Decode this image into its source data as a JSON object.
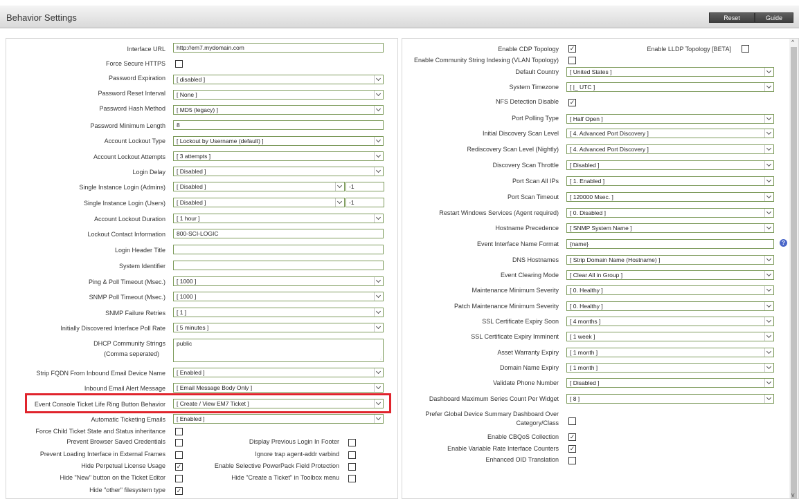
{
  "header": {
    "title": "Behavior Settings",
    "reset_label": "Reset",
    "guide_label": "Guide"
  },
  "left": {
    "url_label": "Interface URL",
    "url_value": "http://em7.mydomain.com",
    "https_label": "Force Secure HTTPS",
    "pw_exp_label": "Password Expiration",
    "pw_exp_value": "[ disabled ]",
    "pw_reset_label": "Password Reset Interval",
    "pw_reset_value": "[ None ]",
    "pw_hash_label": "Password Hash Method",
    "pw_hash_value": "[ MD5 (legacy) ]",
    "pw_min_label": "Password Minimum Length",
    "pw_min_value": "8",
    "lock_type_label": "Account Lockout Type",
    "lock_type_value": "[ Lockout by Username (default) ]",
    "lock_att_label": "Account Lockout Attempts",
    "lock_att_value": "[ 3 attempts ]",
    "login_delay_label": "Login Delay",
    "login_delay_value": "[ Disabled ]",
    "sil_admin_label": "Single Instance Login (Admins)",
    "sil_admin_value": "[ Disabled ]",
    "sil_admin_num": "-1",
    "sil_user_label": "Single Instance Login (Users)",
    "sil_user_value": "[ Disabled ]",
    "sil_user_num": "-1",
    "lock_dur_label": "Account Lockout Duration",
    "lock_dur_value": "[ 1 hour ]",
    "lock_contact_label": "Lockout Contact Information",
    "lock_contact_value": "800-SCI-LOGIC",
    "login_header_label": "Login Header Title",
    "sys_id_label": "System Identifier",
    "ping_label": "Ping & Poll Timeout (Msec.)",
    "ping_value": "[ 1000 ]",
    "snmp_to_label": "SNMP Poll Timeout (Msec.)",
    "snmp_to_value": "[ 1000 ]",
    "snmp_retry_label": "SNMP Failure Retries",
    "snmp_retry_value": "[ 1 ]",
    "poll_rate_label": "Initially Discovered Interface Poll Rate",
    "poll_rate_value": "[ 5 minutes ]",
    "dhcp_label_1": "DHCP Community Strings",
    "dhcp_label_2": "(Comma seperated)",
    "dhcp_value": "public",
    "strip_fqdn_label": "Strip FQDN From Inbound Email Device Name",
    "strip_fqdn_value": "[ Enabled ]",
    "inbound_msg_label": "Inbound Email Alert Message",
    "inbound_msg_value": "[ Email Message Body Only ]",
    "ticket_ring_label": "Event Console Ticket Life Ring Button Behavior",
    "ticket_ring_value": "[ Create / View EM7 Ticket ]",
    "auto_ticket_label": "Automatic Ticketing Emails",
    "auto_ticket_value": "[ Enabled ]",
    "force_child_label": "Force Child Ticket State and Status inheritance",
    "prevent_saved_label": "Prevent Browser Saved Credentials",
    "prevent_frames_label": "Prevent Loading Interface in External Frames",
    "hide_perp_label": "Hide Perpetual License Usage",
    "hide_new_label": "Hide \"New\" button on the Ticket Editor",
    "hide_other_label": "Hide \"other\" filesystem type",
    "prev_login_label": "Display Previous Login In Footer",
    "ignore_trap_label": "Ignore trap agent-addr varbind",
    "selective_pp_label": "Enable Selective PowerPack Field Protection",
    "hide_create_label": "Hide \"Create a Ticket\" in Toolbox menu",
    "check": "✓"
  },
  "right": {
    "cdp_label": "Enable CDP Topology",
    "lldp_label": "Enable LLDP Topology [BETA]",
    "vlan_label": "Enable Community String Indexing (VLAN Topology)",
    "country_label": "Default Country",
    "country_value": "[ United States ]",
    "tz_label": "System Timezone",
    "tz_value": "[ |_ UTC ]",
    "nfs_label": "NFS Detection Disable",
    "port_poll_label": "Port Polling Type",
    "port_poll_value": "[ Half Open ]",
    "init_scan_label": "Initial Discovery Scan Level",
    "init_scan_value": "[ 4. Advanced Port Discovery ]",
    "rediscovery_label": "Rediscovery Scan Level (Nightly)",
    "rediscovery_value": "[ 4. Advanced Port Discovery ]",
    "throttle_label": "Discovery Scan Throttle",
    "throttle_value": "[ Disabled ]",
    "scan_all_label": "Port Scan All IPs",
    "scan_all_value": "[ 1. Enabled ]",
    "scan_to_label": "Port Scan Timeout",
    "scan_to_value": "[ 120000 Msec. ]",
    "restart_label": "Restart Windows Services (Agent required)",
    "restart_value": "[ 0. Disabled ]",
    "hostname_label": "Hostname Precedence",
    "hostname_value": "[ SNMP System Name ]",
    "iface_fmt_label": "Event Interface Name Format",
    "iface_fmt_value": "{name}",
    "dns_label": "DNS Hostnames",
    "dns_value": "[ Strip Domain Name (Hostname) ]",
    "clear_label": "Event Clearing Mode",
    "clear_value": "[ Clear All in Group ]",
    "maint_label": "Maintenance Minimum Severity",
    "maint_value": "[ 0. Healthy ]",
    "patch_label": "Patch Maintenance Minimum Severity",
    "patch_value": "[ 0. Healthy ]",
    "ssl_soon_label": "SSL Certificate Expiry Soon",
    "ssl_soon_value": "[ 4 months ]",
    "ssl_imm_label": "SSL Certificate Expiry Imminent",
    "ssl_imm_value": "[ 1 week ]",
    "warranty_label": "Asset Warranty Expiry",
    "warranty_value": "[ 1 month ]",
    "domain_label": "Domain Name Expiry",
    "domain_value": "[ 1 month ]",
    "phone_label": "Validate Phone Number",
    "phone_value": "[ Disabled ]",
    "dash_max_label": "Dashboard Maximum Series Count Per Widget",
    "dash_max_value": "[ 8 ]",
    "prefer_label_1": "Prefer Global Device Summary Dashboard Over",
    "prefer_label_2": "Category/Class",
    "cbqos_label": "Enable CBQoS Collection",
    "var_rate_label": "Enable Variable Rate Interface Counters",
    "oid_label": "Enhanced OID Translation",
    "help_glyph": "?"
  },
  "scrollbar": {
    "up": "^",
    "down": "v"
  }
}
